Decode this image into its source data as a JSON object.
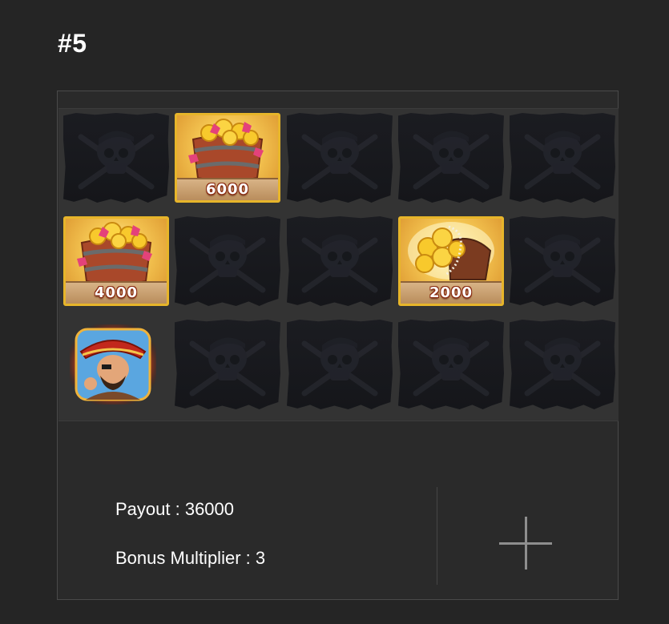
{
  "header": {
    "title": "#5"
  },
  "grid": {
    "rows": [
      [
        {
          "kind": "flag"
        },
        {
          "kind": "treasure",
          "icon": "coin-barrel-icon",
          "value": "6000"
        },
        {
          "kind": "flag"
        },
        {
          "kind": "flag"
        },
        {
          "kind": "flag"
        }
      ],
      [
        {
          "kind": "treasure",
          "icon": "coin-barrel-icon",
          "value": "4000"
        },
        {
          "kind": "flag"
        },
        {
          "kind": "flag"
        },
        {
          "kind": "treasure",
          "icon": "treasure-chest-icon",
          "value": "2000"
        },
        {
          "kind": "flag"
        }
      ],
      [
        {
          "kind": "pirate",
          "icon": "pirate-captain-icon"
        },
        {
          "kind": "flag"
        },
        {
          "kind": "flag"
        },
        {
          "kind": "flag"
        },
        {
          "kind": "flag"
        }
      ]
    ]
  },
  "summary": {
    "payout_label": "Payout : 36000",
    "multiplier_label": "Bonus Multiplier : 3"
  },
  "icons": {
    "add": "plus-icon",
    "flag": "pirate-flag-icon"
  },
  "colors": {
    "background": "#252525",
    "gold_border": "#e7b52a",
    "value_outline": "#8a2a10"
  }
}
